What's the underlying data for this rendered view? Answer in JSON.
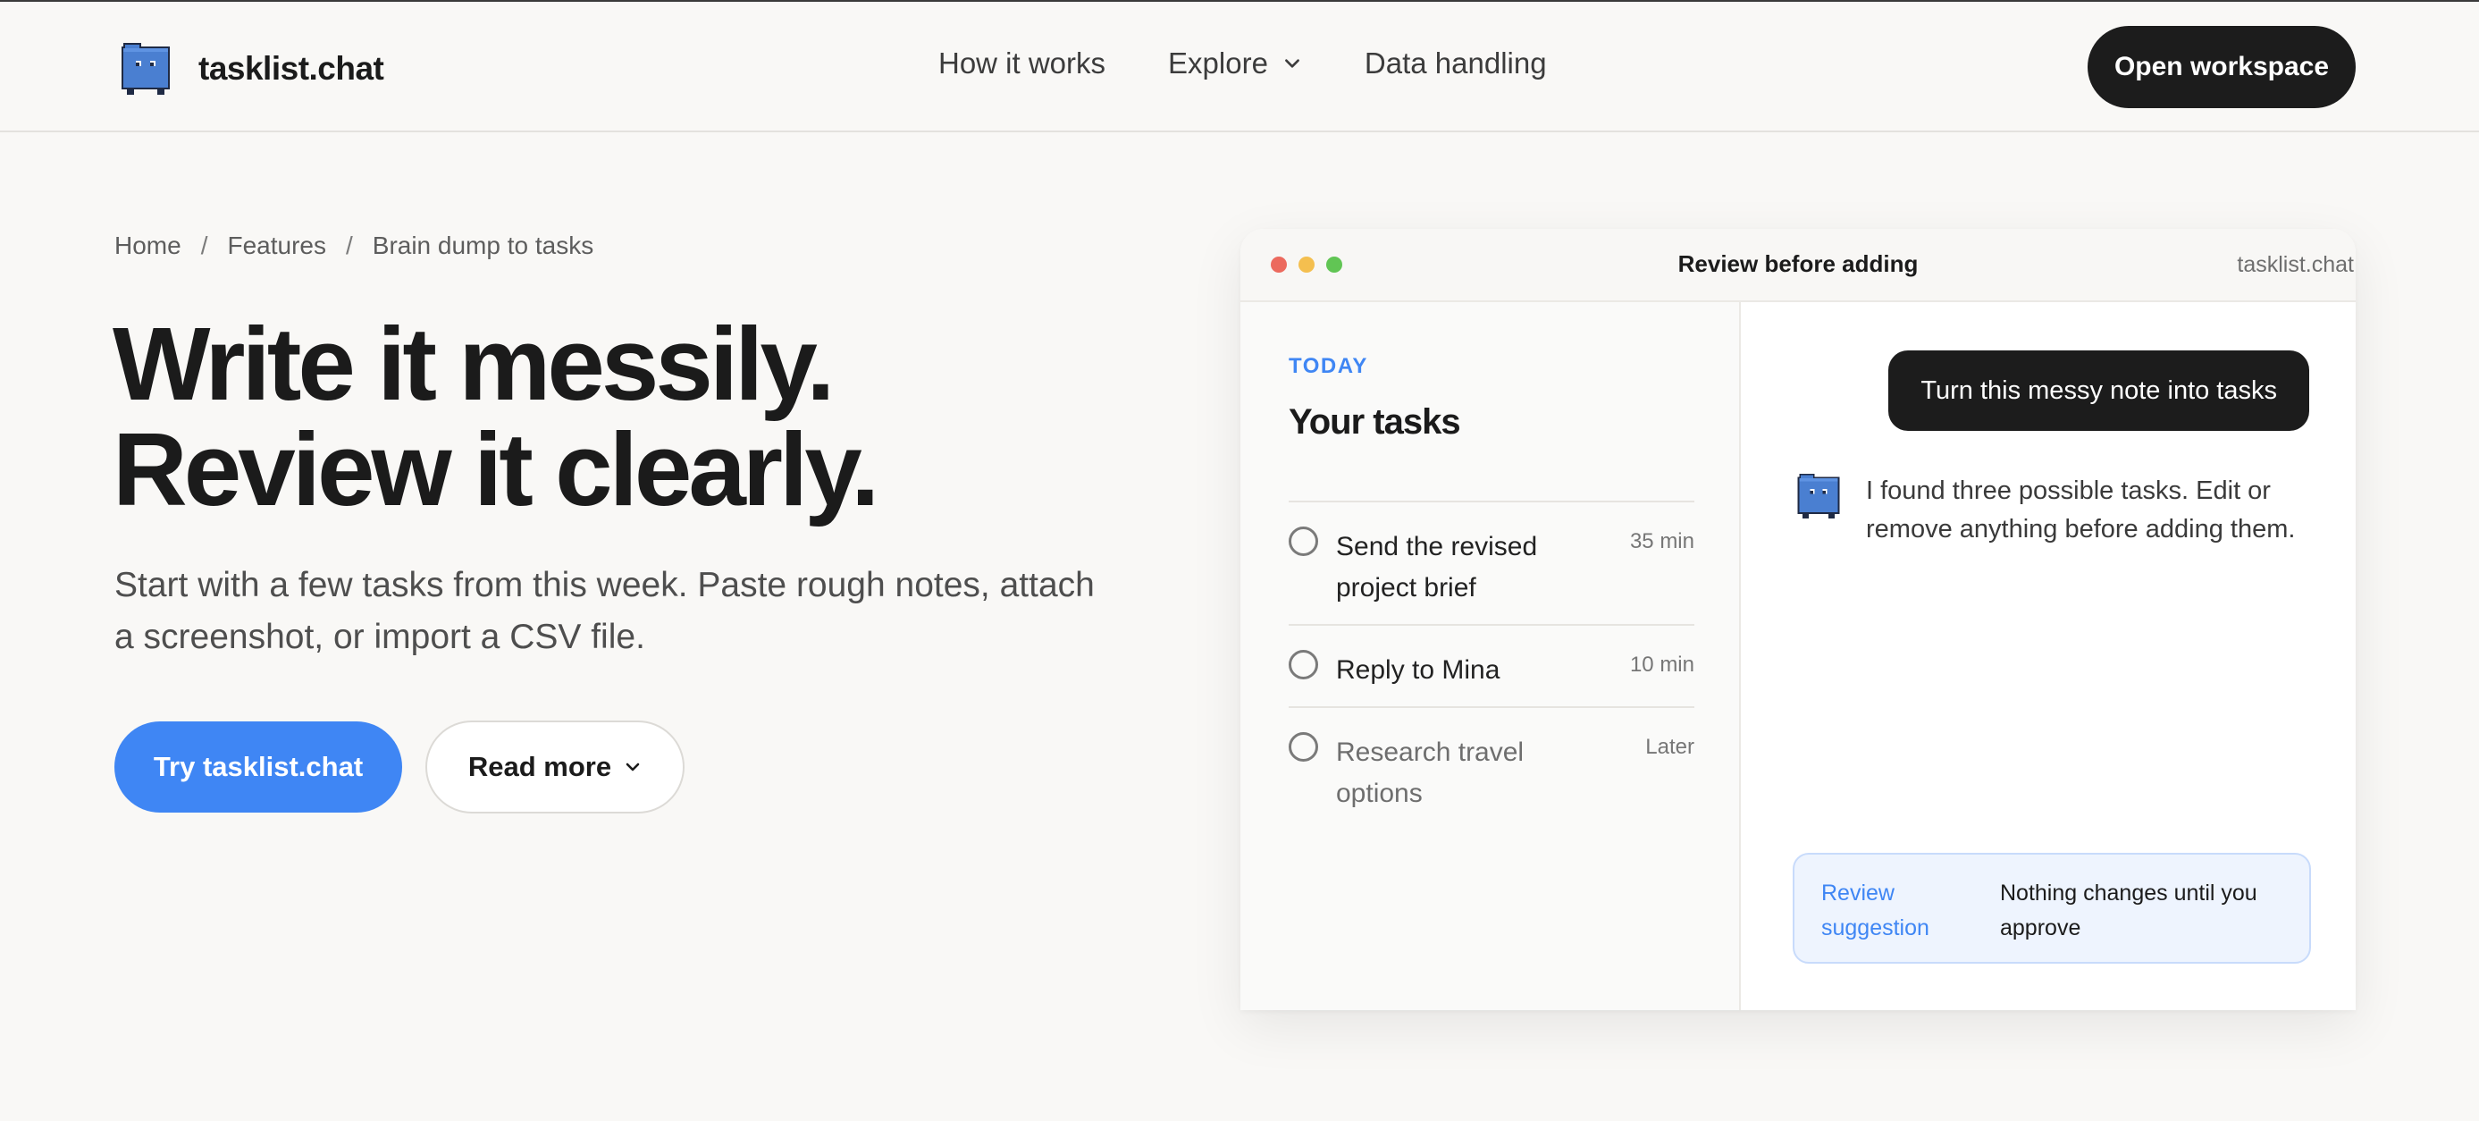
{
  "header": {
    "brand": "tasklist.chat",
    "nav": [
      {
        "label": "How it works"
      },
      {
        "label": "Explore",
        "has_dropdown": true
      },
      {
        "label": "Data handling"
      }
    ],
    "cta": "Open workspace"
  },
  "breadcrumb": {
    "items": [
      "Home",
      "Features",
      "Brain dump to tasks"
    ],
    "separator": "/"
  },
  "hero": {
    "headline_line1": "Write it messily.",
    "headline_line2": "Review it clearly.",
    "subtext": "Start with a few tasks from this week. Paste rough notes, attach a screenshot, or import a CSV file.",
    "primary_button": "Try tasklist.chat",
    "secondary_button": "Read more"
  },
  "preview": {
    "window_title": "Review before adding",
    "window_domain": "tasklist.chat",
    "section_label": "TODAY",
    "tasks_title": "Your tasks",
    "tasks": [
      {
        "label": "Send the revised project brief",
        "time": "35 min"
      },
      {
        "label": "Reply to Mina",
        "time": "10 min"
      },
      {
        "label": "Research travel options",
        "time": "Later"
      }
    ],
    "user_message": "Turn this messy note into tasks",
    "bot_message": "I found three possible tasks. Edit or remove anything before adding them.",
    "review_link": "Review suggestion",
    "review_note": "Nothing changes until you approve"
  },
  "colors": {
    "accent_blue": "#3f86f4",
    "dark": "#1c1c1c",
    "background": "#f9f8f6",
    "logo_blue": "#4a7fd1"
  },
  "icons": {
    "logo": "folder-face-icon",
    "explore_chevron": "chevron-down-icon",
    "read_more_chevron": "chevron-down-icon",
    "task_check": "circle-checkbox-icon",
    "bot_avatar": "folder-face-icon"
  }
}
